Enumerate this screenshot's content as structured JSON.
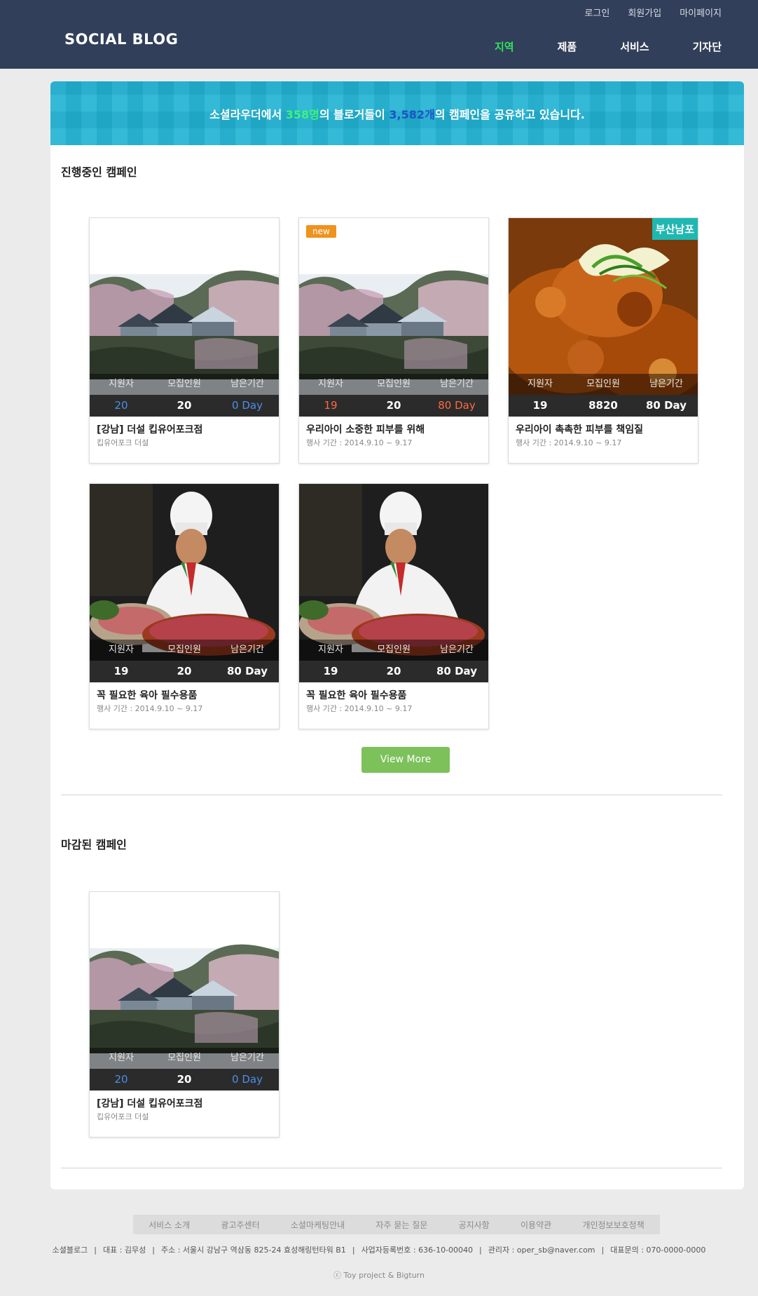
{
  "header": {
    "logo": "SOCIAL BLOG",
    "util_links": [
      "로그인",
      "회원가입",
      "마이페이지"
    ],
    "nav": [
      {
        "label": "지역",
        "active": true
      },
      {
        "label": "제품",
        "active": false
      },
      {
        "label": "서비스",
        "active": false
      },
      {
        "label": "기자단",
        "active": false
      }
    ]
  },
  "banner": {
    "prefix": "소셜라우더에서 ",
    "blogger_count": "358명",
    "middle": "의 블로거들이 ",
    "campaign_count": "3,582개",
    "suffix": "의 캠페인을 공유하고 있습니다."
  },
  "active_section": {
    "title": "진행중인 캠페인",
    "cards": [
      {
        "image": "pavilion-photo",
        "badge": "",
        "applicants": "20",
        "recruits": "20",
        "days_left": "0 Day",
        "title": "[강남] 더설 킵유어포크점",
        "subtitle": "킵유어포크 더설"
      },
      {
        "image": "pavilion-photo",
        "badge": "new",
        "applicants": "19",
        "recruits": "20",
        "days_left": "80 Day",
        "title": "우리아이 소중한 피부를 위해",
        "subtitle": "행사 기간 : 2014.9.10 ~ 9.17"
      },
      {
        "image": "food-photo",
        "badge": "부산남포",
        "applicants": "19",
        "recruits": "8820",
        "days_left": "80 Day",
        "title": "우리아이 촉촉한 피부를 책임질",
        "subtitle": "행사 기간 : 2014.9.10 ~ 9.17"
      },
      {
        "image": "chef-photo",
        "badge": "",
        "applicants": "19",
        "recruits": "20",
        "days_left": "80 Day",
        "title": "꼭 필요한 육아 필수용품",
        "subtitle": "행사 기간 : 2014.9.10 ~ 9.17"
      },
      {
        "image": "chef-photo",
        "badge": "",
        "applicants": "19",
        "recruits": "20",
        "days_left": "80 Day",
        "title": "꼭 필요한 육아 필수용품",
        "subtitle": "행사 기간 : 2014.9.10 ~ 9.17"
      }
    ],
    "view_more_label": "View More"
  },
  "closed_section": {
    "title": "마감된 캠페인",
    "cards": [
      {
        "image": "pavilion-photo",
        "badge": "",
        "applicants": "20",
        "recruits": "20",
        "days_left": "0 Day",
        "title": "[강남] 더설 킵유어포크점",
        "subtitle": "킵유어포크 더설"
      }
    ]
  },
  "stat_labels": {
    "applicants": "지원자",
    "recruits": "모집인원",
    "days_left": "남은기간"
  },
  "footer": {
    "nav": [
      "서비스 소개",
      "광고주센터",
      "소셜마케팅안내",
      "자주 묻는 질문",
      "공지사항",
      "이용약관",
      "개인정보보호정책"
    ],
    "company": "소셜블로그",
    "ceo": "대표 : 김무성",
    "address": "주소 : 서울시 강남구 역삼동 825-24 효성해링턴타워 B1",
    "biz_no": "사업자등록번호 : 636-10-00040",
    "admin": "관리자 : oper_sb@naver.com",
    "phone": "대표문의 : 070-0000-0000",
    "copyright": "ⓒ Toy project & Bigturn"
  },
  "colors": {
    "header_bg": "#323f5a",
    "nav_active": "#2ee35a",
    "banner_bg": "#20b2d2",
    "accent_blue": "#4b8ee8",
    "accent_red": "#ff6a40",
    "view_more_bg": "#7dc15b",
    "badge_new": "#f0921e",
    "badge_region": "#1fb7b2"
  }
}
